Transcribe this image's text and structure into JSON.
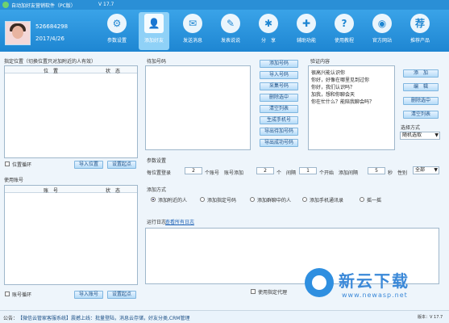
{
  "titlebar": {
    "title": "自动加好友营销软件（PC版）",
    "version": "V 17.7"
  },
  "user": {
    "id": "526684298",
    "date": "2017/4/26"
  },
  "nav": [
    {
      "label": "参数设置",
      "icon": "gear-icon",
      "glyph": "⚙"
    },
    {
      "label": "添加好友",
      "icon": "add-friend-icon",
      "glyph": "👤"
    },
    {
      "label": "发送消息",
      "icon": "chat-bubble-icon",
      "glyph": "✉"
    },
    {
      "label": "发表说说",
      "icon": "speech-icon",
      "glyph": "✎"
    },
    {
      "label": "分　享",
      "icon": "share-icon",
      "glyph": "✱"
    },
    {
      "label": "辅助功能",
      "icon": "helper-icon",
      "glyph": "✚"
    },
    {
      "label": "使用教程",
      "icon": "help-doc-icon",
      "glyph": "?"
    },
    {
      "label": "官方网站",
      "icon": "globe-icon",
      "glyph": "◉"
    },
    {
      "label": "推荐产品",
      "icon": "recommend-icon",
      "glyph": "荐"
    }
  ],
  "location": {
    "label": "指定位置（切换位置只对加附近的人有效）",
    "col1": "位　置",
    "col2": "状　态",
    "loop_label": "位置循环",
    "import_btn": "导入位置",
    "settings_btn": "设置起点"
  },
  "accounts": {
    "label": "使用账号",
    "col1": "账　号",
    "col2": "状　态",
    "loop_label": "账号循环",
    "import_btn": "导入账号",
    "settings_btn": "设置起点"
  },
  "pending": {
    "label": "待加号码",
    "buttons": [
      "添加号码",
      "导入号码",
      "采集号码",
      "删除选中",
      "清空列表",
      "生成手机号",
      "导出待加号码",
      "导出成功号码"
    ]
  },
  "verify": {
    "label": "验证内容",
    "lines": [
      "很高兴能认识你",
      "你好，好像在哪里见到过你",
      "你好，我们认识吗？",
      "加我，想和你聊会天",
      "你在忙什么？能陪我聊会吗？"
    ],
    "buttons": [
      "添　加",
      "编　辑",
      "删除选中",
      "清空列表"
    ],
    "mode_label": "选择方式",
    "mode_value": "随机选取"
  },
  "params": {
    "label": "参数设置",
    "per_location_label": "每位置登录",
    "per_location": "2",
    "per_account_label": "个账号　账号添加",
    "per_account": "2",
    "interval_label": "个　间隔",
    "interval": "1",
    "start_label": "个开始　添加间隔",
    "start": "5",
    "gender_label": "秒　性别",
    "gender": "全部"
  },
  "method": {
    "label": "添加方式",
    "options": [
      "添加附近的人",
      "添加指定号码",
      "添加群聊中的人",
      "添加手机通讯录",
      "摇一摇"
    ],
    "selected": 0
  },
  "log": {
    "label": "运行日志",
    "link": "查看所有日志"
  },
  "bottom": {
    "proxy_label": "使用指定代理"
  },
  "status": {
    "notice_label": "公告：",
    "notice": "【微信云管家客服系统】震撼上线：批量登陆，消息云存储，好友分类,CRM管理",
    "version": "版本：V 17.7"
  },
  "watermark": {
    "text": "新云下载",
    "url": "www.newasp.net"
  }
}
